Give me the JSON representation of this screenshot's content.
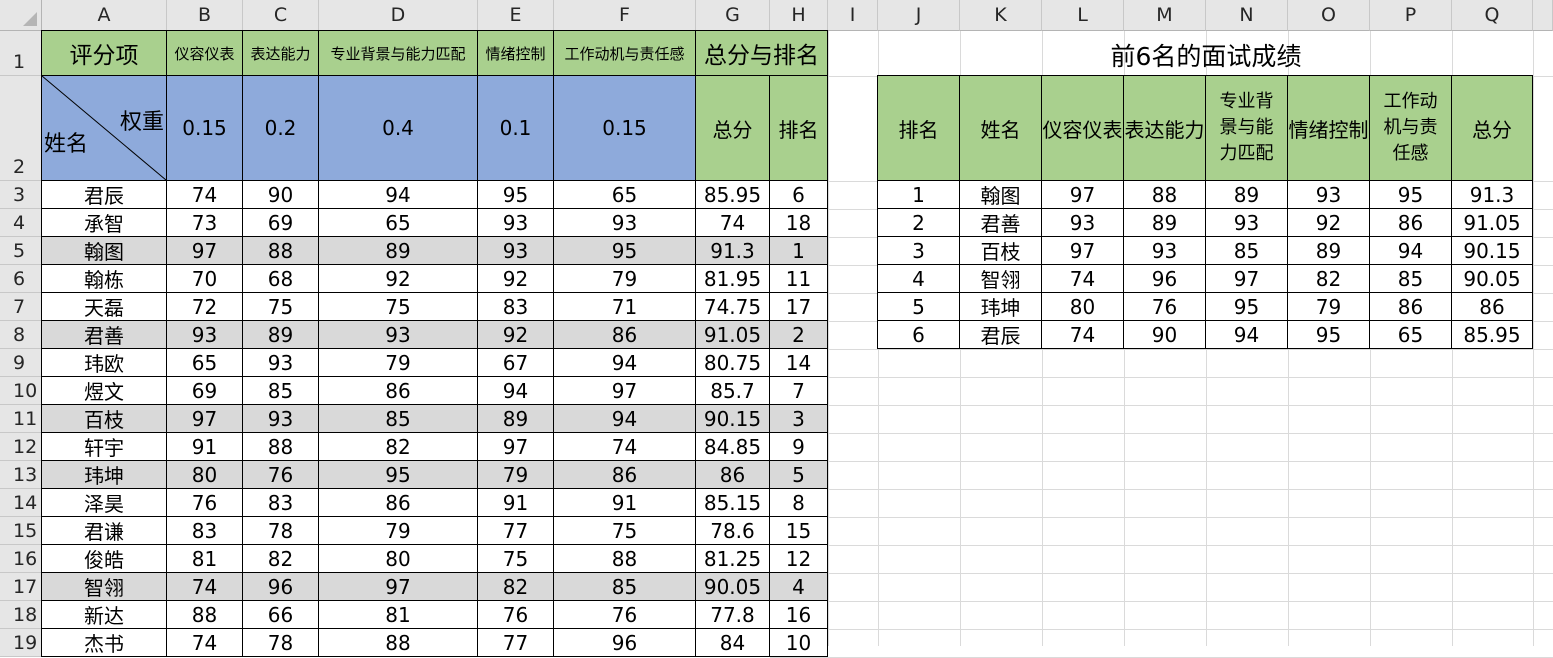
{
  "columns": [
    "A",
    "B",
    "C",
    "D",
    "E",
    "F",
    "G",
    "H",
    "I",
    "J",
    "K",
    "L",
    "M",
    "N",
    "O",
    "P",
    "Q"
  ],
  "rows": [
    "1",
    "2",
    "3",
    "4",
    "5",
    "6",
    "7",
    "8",
    "9",
    "10",
    "11",
    "12",
    "13",
    "14",
    "15",
    "16",
    "17",
    "18",
    "19"
  ],
  "left_table": {
    "header": {
      "item": "评分项",
      "b": "仪容仪表",
      "c": "表达能力",
      "d": "专业背景与能力匹配",
      "e": "情绪控制",
      "f": "工作动机与责任感",
      "gh": "总分与排名",
      "diag_top": "权重",
      "diag_bottom": "姓名",
      "weights": [
        "0.15",
        "0.2",
        "0.4",
        "0.1",
        "0.15"
      ],
      "total": "总分",
      "rank": "排名"
    },
    "rows": [
      {
        "name": "君辰",
        "b": "74",
        "c": "90",
        "d": "94",
        "e": "95",
        "f": "65",
        "total": "85.95",
        "rank": "6",
        "highlight": false
      },
      {
        "name": "承智",
        "b": "73",
        "c": "69",
        "d": "65",
        "e": "93",
        "f": "93",
        "total": "74",
        "rank": "18",
        "highlight": false
      },
      {
        "name": "翰图",
        "b": "97",
        "c": "88",
        "d": "89",
        "e": "93",
        "f": "95",
        "total": "91.3",
        "rank": "1",
        "highlight": true
      },
      {
        "name": "翰栋",
        "b": "70",
        "c": "68",
        "d": "92",
        "e": "92",
        "f": "79",
        "total": "81.95",
        "rank": "11",
        "highlight": false
      },
      {
        "name": "天磊",
        "b": "72",
        "c": "75",
        "d": "75",
        "e": "83",
        "f": "71",
        "total": "74.75",
        "rank": "17",
        "highlight": false
      },
      {
        "name": "君善",
        "b": "93",
        "c": "89",
        "d": "93",
        "e": "92",
        "f": "86",
        "total": "91.05",
        "rank": "2",
        "highlight": true
      },
      {
        "name": "玮欧",
        "b": "65",
        "c": "93",
        "d": "79",
        "e": "67",
        "f": "94",
        "total": "80.75",
        "rank": "14",
        "highlight": false
      },
      {
        "name": "煜文",
        "b": "69",
        "c": "85",
        "d": "86",
        "e": "94",
        "f": "97",
        "total": "85.7",
        "rank": "7",
        "highlight": false
      },
      {
        "name": "百枝",
        "b": "97",
        "c": "93",
        "d": "85",
        "e": "89",
        "f": "94",
        "total": "90.15",
        "rank": "3",
        "highlight": true
      },
      {
        "name": "轩宇",
        "b": "91",
        "c": "88",
        "d": "82",
        "e": "97",
        "f": "74",
        "total": "84.85",
        "rank": "9",
        "highlight": false
      },
      {
        "name": "玮坤",
        "b": "80",
        "c": "76",
        "d": "95",
        "e": "79",
        "f": "86",
        "total": "86",
        "rank": "5",
        "highlight": true
      },
      {
        "name": "泽昊",
        "b": "76",
        "c": "83",
        "d": "86",
        "e": "91",
        "f": "91",
        "total": "85.15",
        "rank": "8",
        "highlight": false
      },
      {
        "name": "君谦",
        "b": "83",
        "c": "78",
        "d": "79",
        "e": "77",
        "f": "75",
        "total": "78.6",
        "rank": "15",
        "highlight": false
      },
      {
        "name": "俊皓",
        "b": "81",
        "c": "82",
        "d": "80",
        "e": "75",
        "f": "88",
        "total": "81.25",
        "rank": "12",
        "highlight": false
      },
      {
        "name": "智翎",
        "b": "74",
        "c": "96",
        "d": "97",
        "e": "82",
        "f": "85",
        "total": "90.05",
        "rank": "4",
        "highlight": true
      },
      {
        "name": "新达",
        "b": "88",
        "c": "66",
        "d": "81",
        "e": "76",
        "f": "76",
        "total": "77.8",
        "rank": "16",
        "highlight": false
      },
      {
        "name": "杰书",
        "b": "74",
        "c": "78",
        "d": "88",
        "e": "77",
        "f": "96",
        "total": "84",
        "rank": "10",
        "highlight": false
      }
    ]
  },
  "right_table": {
    "title": "前6名的面试成绩",
    "headers": [
      "排名",
      "姓名",
      "仪容仪表",
      "表达能力",
      "专业背景与能力匹配",
      "情绪控制",
      "工作动机与责任感",
      "总分"
    ],
    "rows": [
      [
        "1",
        "翰图",
        "97",
        "88",
        "89",
        "93",
        "95",
        "91.3"
      ],
      [
        "2",
        "君善",
        "93",
        "89",
        "93",
        "92",
        "86",
        "91.05"
      ],
      [
        "3",
        "百枝",
        "97",
        "93",
        "85",
        "89",
        "94",
        "90.15"
      ],
      [
        "4",
        "智翎",
        "74",
        "96",
        "97",
        "82",
        "85",
        "90.05"
      ],
      [
        "5",
        "玮坤",
        "80",
        "76",
        "95",
        "79",
        "86",
        "86"
      ],
      [
        "6",
        "君辰",
        "74",
        "90",
        "94",
        "95",
        "65",
        "85.95"
      ]
    ]
  },
  "colors": {
    "header_green": "#a9d08e",
    "weight_blue": "#8eaadb",
    "highlight_gray": "#d9d9d9",
    "sheet_header_bg": "#e6e6e6"
  }
}
